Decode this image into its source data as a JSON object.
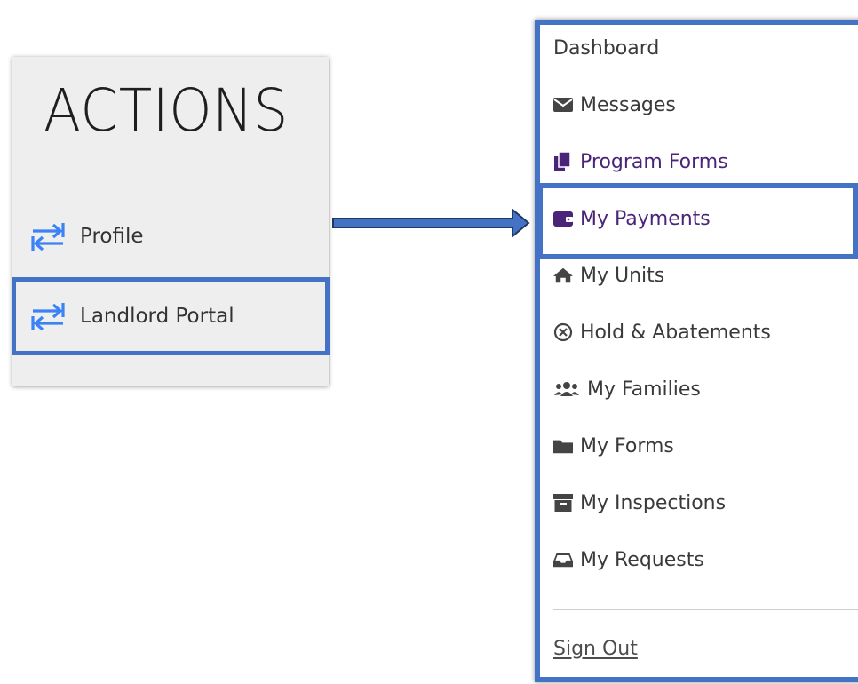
{
  "actions": {
    "title": "ACTIONS",
    "items": [
      {
        "label": "Profile",
        "icon": "swap-arrows-icon"
      },
      {
        "label": "Landlord Portal",
        "icon": "swap-arrows-icon"
      }
    ]
  },
  "menu": {
    "items": [
      {
        "label": "Dashboard",
        "icon": ""
      },
      {
        "label": "Messages",
        "icon": "envelope-icon"
      },
      {
        "label": "Program Forms",
        "icon": "copy-files-icon"
      },
      {
        "label": "My Payments",
        "icon": "wallet-icon"
      },
      {
        "label": "My Units",
        "icon": "home-icon"
      },
      {
        "label": "Hold & Abatements",
        "icon": "circle-x-icon"
      },
      {
        "label": "My Families",
        "icon": "users-icon"
      },
      {
        "label": "My Forms",
        "icon": "folder-icon"
      },
      {
        "label": "My Inspections",
        "icon": "archive-icon"
      },
      {
        "label": "My Requests",
        "icon": "inbox-icon"
      }
    ],
    "sign_out": "Sign Out"
  },
  "colors": {
    "highlight_border": "#4472c4",
    "swap_icon": "#3b82f6",
    "active_purple": "#4a2478",
    "text": "#3a3a3a"
  }
}
